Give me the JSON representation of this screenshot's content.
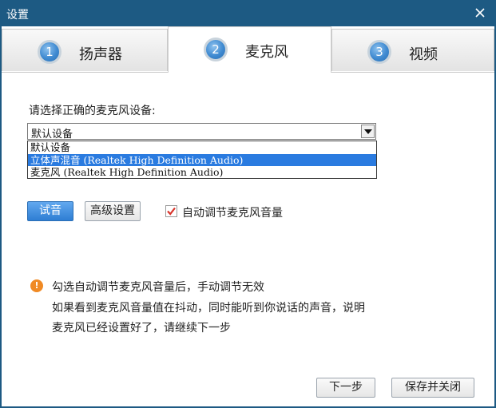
{
  "window": {
    "title": "设置"
  },
  "tabs": [
    {
      "num": "1",
      "label": "扬声器"
    },
    {
      "num": "2",
      "label": "麦克风"
    },
    {
      "num": "3",
      "label": "视频"
    }
  ],
  "microphone": {
    "prompt": "请选择正确的麦克风设备:",
    "selected": "默认设备",
    "options": [
      "默认设备",
      "立体声混音 (Realtek High Definition Audio)",
      "麦克风 (Realtek High Definition Audio)"
    ],
    "highlighted_index": 1,
    "test_button": "试音",
    "advanced_button": "高级设置",
    "auto_adjust_label": "自动调节麦克风音量",
    "auto_adjust_checked": true
  },
  "notes": [
    "勾选自动调节麦克风音量后，手动调节无效",
    "如果看到麦克风音量值在抖动，同时能听到你说话的声音，说明",
    "麦克风已经设置好了，请继续下一步"
  ],
  "footer": {
    "next_button": "下一步",
    "save_button": "保存并关闭"
  },
  "colors": {
    "titlebar": "#1d5a83",
    "selection": "#2a7be0",
    "primary_button": "#2e7ed3",
    "info": "#f08a24"
  }
}
